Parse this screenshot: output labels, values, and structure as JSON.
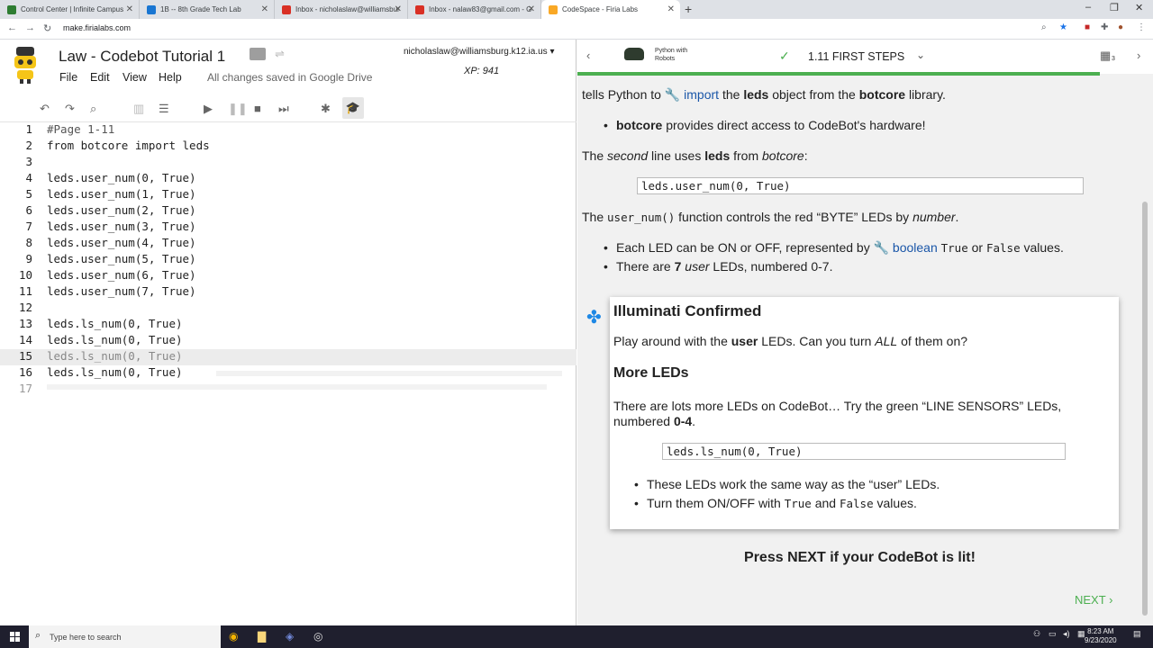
{
  "browser": {
    "tabs": [
      {
        "title": "Control Center | Infinite Campus",
        "color": "#2e7d32"
      },
      {
        "title": "1B -- 8th Grade Tech Lab",
        "color": "#1976d2"
      },
      {
        "title": "Inbox - nicholaslaw@williamsbur",
        "color": "#d93025"
      },
      {
        "title": "Inbox - nalaw83@gmail.com - G",
        "color": "#d93025"
      },
      {
        "title": "CodeSpace - Firia Labs",
        "color": "#f9a825"
      }
    ],
    "url": "make.firialabs.com"
  },
  "ide": {
    "doc_title": "Law - Codebot Tutorial 1",
    "menus": [
      "File",
      "Edit",
      "View",
      "Help"
    ],
    "save_status": "All changes saved in Google Drive",
    "user_email": "nicholaslaw@williamsburg.k12.ia.us",
    "xp": "XP: 941",
    "code_lines": [
      {
        "n": "1",
        "text": "#Page 1-11"
      },
      {
        "n": "2",
        "text": "from botcore import leds"
      },
      {
        "n": "3",
        "text": ""
      },
      {
        "n": "4",
        "text": "leds.user_num(0, True)"
      },
      {
        "n": "5",
        "text": "leds.user_num(1, True)"
      },
      {
        "n": "6",
        "text": "leds.user_num(2, True)"
      },
      {
        "n": "7",
        "text": "leds.user_num(3, True)"
      },
      {
        "n": "8",
        "text": "leds.user_num(4, True)"
      },
      {
        "n": "9",
        "text": "leds.user_num(5, True)"
      },
      {
        "n": "10",
        "text": "leds.user_num(6, True)"
      },
      {
        "n": "11",
        "text": "leds.user_num(7, True)"
      },
      {
        "n": "12",
        "text": ""
      },
      {
        "n": "13",
        "text": "leds.ls_num(0, True)"
      },
      {
        "n": "14",
        "text": "leds.ls_num(0, True)"
      },
      {
        "n": "15",
        "text": "leds.ls_num(0, True)"
      },
      {
        "n": "16",
        "text": "leds.ls_num(0, True)"
      },
      {
        "n": "17",
        "text": ""
      }
    ]
  },
  "lesson": {
    "header": {
      "brand_line1": "Python with",
      "brand_line2": "Robots",
      "title": "1.11 FIRST STEPS",
      "badge": "3"
    },
    "p1_a": "tells Python to ",
    "p1_link": "import",
    "p1_b": " the ",
    "p1_c": "leds",
    "p1_d": " object from the ",
    "p1_e": "botcore",
    "p1_f": " library.",
    "b1_a": "botcore",
    "b1_b": " provides direct access to CodeBot's hardware!",
    "p2_a": "The ",
    "p2_b": "second",
    "p2_c": " line uses ",
    "p2_d": "leds",
    "p2_e": " from ",
    "p2_f": "botcore",
    "p2_g": ":",
    "code1": "leds.user_num(0, True)",
    "p3_a": "The ",
    "p3_b": "user_num()",
    "p3_c": " function controls the red “BYTE” LEDs by ",
    "p3_d": "number",
    "p3_e": ".",
    "b2_a": "Each LED can be ON or OFF, represented by ",
    "b2_link": "boolean",
    "b2_b": "True",
    "b2_c": " or ",
    "b2_d": "False",
    "b2_e": " values.",
    "b3_a": "There are ",
    "b3_b": "7",
    "b3_c": "user",
    "b3_d": " LEDs, numbered 0-7.",
    "card": {
      "title": "Illuminati Confirmed",
      "t1_a": "Play around with the ",
      "t1_b": "user",
      "t1_c": " LEDs. Can you turn ",
      "t1_d": "ALL",
      "t1_e": " of them on?",
      "h2": "More LEDs",
      "t2_a": "There are lots more LEDs on CodeBot… Try the green “LINE SENSORS” LEDs,",
      "t2_b": "numbered ",
      "t2_c": "0-4",
      "t2_d": ".",
      "code2": "leds.ls_num(0, True)",
      "b4": "These LEDs work the same way as the “user” LEDs.",
      "b5_a": "Turn them ON/OFF with ",
      "b5_b": "True",
      "b5_c": " and ",
      "b5_d": "False",
      "b5_e": " values."
    },
    "press_next": "Press NEXT if your CodeBot is lit!",
    "next_label": "NEXT"
  },
  "taskbar": {
    "search_placeholder": "Type here to search",
    "time": "8:23 AM",
    "date": "9/23/2020"
  }
}
